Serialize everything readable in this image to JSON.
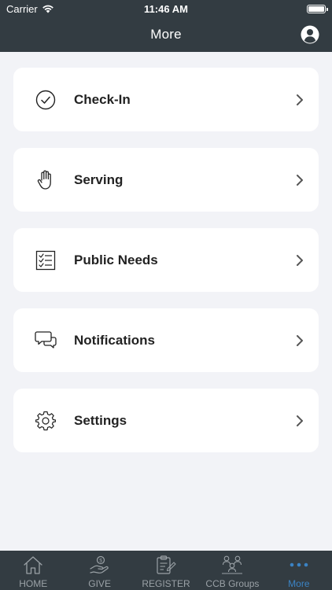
{
  "status_bar": {
    "carrier": "Carrier",
    "time": "11:46 AM"
  },
  "nav": {
    "title": "More",
    "profile_icon": "person-circle-icon"
  },
  "menu": [
    {
      "label": "Check-In",
      "icon": "check-circle-icon"
    },
    {
      "label": "Serving",
      "icon": "hand-icon"
    },
    {
      "label": "Public Needs",
      "icon": "checklist-icon"
    },
    {
      "label": "Notifications",
      "icon": "chat-bubbles-icon"
    },
    {
      "label": "Settings",
      "icon": "gear-icon"
    }
  ],
  "tabs": [
    {
      "label": "HOME",
      "icon": "home-icon"
    },
    {
      "label": "GIVE",
      "icon": "give-hand-coin-icon"
    },
    {
      "label": "REGISTER",
      "icon": "clipboard-pen-icon"
    },
    {
      "label": "CCB Groups",
      "icon": "group-people-icon"
    },
    {
      "label": "More",
      "icon": "more-dots-icon",
      "active": true
    }
  ],
  "colors": {
    "header_bg": "#333c42",
    "page_bg": "#f2f3f7",
    "tab_inactive": "#9aa1a6",
    "tab_active": "#3b83c4"
  }
}
